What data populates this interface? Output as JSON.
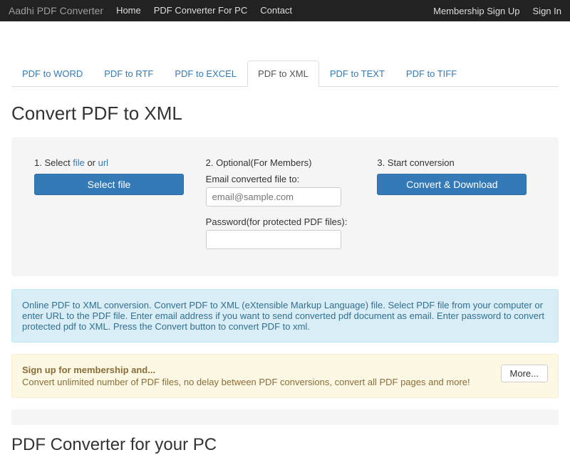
{
  "nav": {
    "brand": "Aadhi PDF Converter",
    "left": [
      "Home",
      "PDF Converter For PC",
      "Contact"
    ],
    "right": [
      "Membership Sign Up",
      "Sign In"
    ]
  },
  "tabs": [
    "PDF to WORD",
    "PDF to RTF",
    "PDF to EXCEL",
    "PDF to XML",
    "PDF to TEXT",
    "PDF to TIFF"
  ],
  "active_tab": 3,
  "heading": "Convert PDF to XML",
  "step1": {
    "prefix": "1. Select ",
    "file": "file",
    "or": " or ",
    "url": "url",
    "button": "Select file"
  },
  "step2": {
    "label": "2. Optional(For Members)",
    "email_label": "Email converted file to:",
    "email_placeholder": "email@sample.com",
    "password_label": "Password(for protected PDF files):"
  },
  "step3": {
    "label": "3. Start conversion",
    "button": "Convert & Download"
  },
  "info": "Online PDF to XML conversion. Convert PDF to XML (eXtensible Markup Language) file. Select PDF file from your computer or enter URL to the PDF file. Enter email address if you want to send converted pdf document as email. Enter password to convert protected pdf to XML. Press the Convert button to convert PDF to xml.",
  "promo": {
    "title": "Sign up for membership and...",
    "text": "Convert unlimited number of PDF files, no delay between PDF conversions, convert all PDF pages and more!",
    "more": "More..."
  },
  "pc_heading": "PDF Converter for your PC"
}
